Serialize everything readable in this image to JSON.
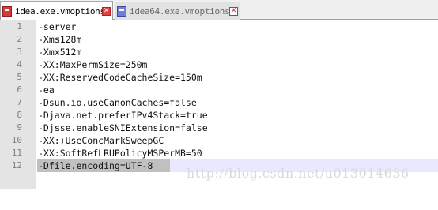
{
  "tabs": [
    {
      "label": "idea.exe.vmoptions",
      "close": "✕",
      "active": true
    },
    {
      "label": "idea64.exe.vmoptions",
      "close": "✕",
      "active": false
    }
  ],
  "editor": {
    "lines": [
      {
        "number": "1",
        "text": "-server"
      },
      {
        "number": "2",
        "text": "-Xms128m"
      },
      {
        "number": "3",
        "text": "-Xmx512m"
      },
      {
        "number": "4",
        "text": "-XX:MaxPermSize=250m"
      },
      {
        "number": "5",
        "text": "-XX:ReservedCodeCacheSize=150m"
      },
      {
        "number": "6",
        "text": "-ea"
      },
      {
        "number": "7",
        "text": "-Dsun.io.useCanonCaches=false"
      },
      {
        "number": "8",
        "text": "-Djava.net.preferIPv4Stack=true"
      },
      {
        "number": "9",
        "text": "-Djsse.enableSNIExtension=false"
      },
      {
        "number": "10",
        "text": "-XX:+UseConcMarkSweepGC"
      },
      {
        "number": "11",
        "text": "-XX:SoftRefLRUPolicyMSPerMB=50"
      },
      {
        "number": "12",
        "text": "-Dfile.encoding=UTF-8"
      }
    ],
    "current_line": "12"
  },
  "watermark": "http://blog.csdn.net/u013014636",
  "colors": {
    "active_tab_accent": "#fa9a2a",
    "current_line_highlight": "#e8e8ff",
    "selection": "#c0c0c0"
  }
}
